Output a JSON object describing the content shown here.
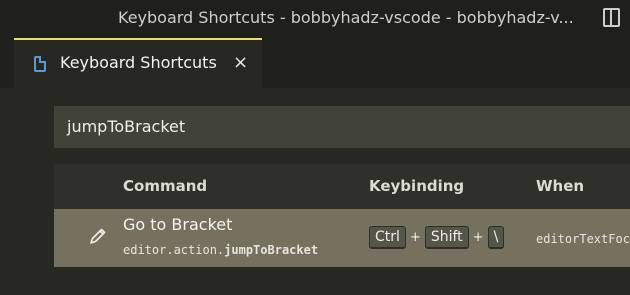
{
  "window": {
    "title": "Keyboard Shortcuts - bobbyhadz-vscode - bobbyhadz-v..."
  },
  "tab": {
    "label": "Keyboard Shortcuts",
    "close": "×"
  },
  "search": {
    "value": "jumpToBracket"
  },
  "table": {
    "headers": {
      "command": "Command",
      "keybinding": "Keybinding",
      "when": "When"
    },
    "rows": [
      {
        "command_title": "Go to Bracket",
        "command_id_prefix": "editor.action.",
        "command_id_bold": "jumpToBracket",
        "keys": [
          "Ctrl",
          "Shift",
          "\\"
        ],
        "separator": "+",
        "when": "editorTextFocus"
      }
    ]
  },
  "colors": {
    "accent": "#e6db74",
    "file_icon": "#5b9bd5",
    "selected_row": "#75715e"
  },
  "icons": {
    "file": "file-icon",
    "close": "close-icon",
    "layout": "layout-icon",
    "edit": "pencil-icon"
  }
}
